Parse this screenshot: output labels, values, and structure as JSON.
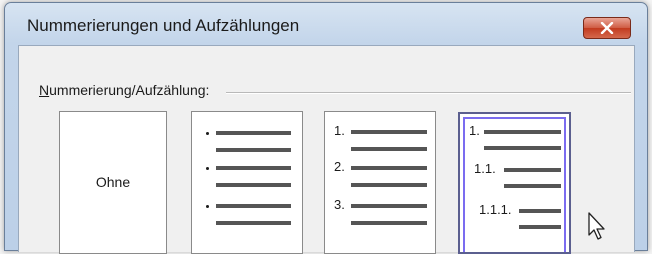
{
  "dialog": {
    "title": "Nummerierungen und Aufzählungen",
    "close_icon": "close-x-icon",
    "close_color": "#c74528"
  },
  "group": {
    "label": "Nummerierung/Aufzählung:",
    "mnemonic": "N"
  },
  "styles": [
    {
      "id": "none",
      "label": "Ohne"
    },
    {
      "id": "bullets",
      "markers": [
        "•",
        "•",
        "•"
      ]
    },
    {
      "id": "numbers",
      "markers": [
        "1.",
        "2.",
        "3."
      ]
    },
    {
      "id": "outline",
      "markers": [
        "1.",
        "1.1.",
        "1.1.1."
      ],
      "selected": true
    }
  ],
  "cursor_icon": "mouse-pointer-icon",
  "selection_color": "#7b6cf0"
}
